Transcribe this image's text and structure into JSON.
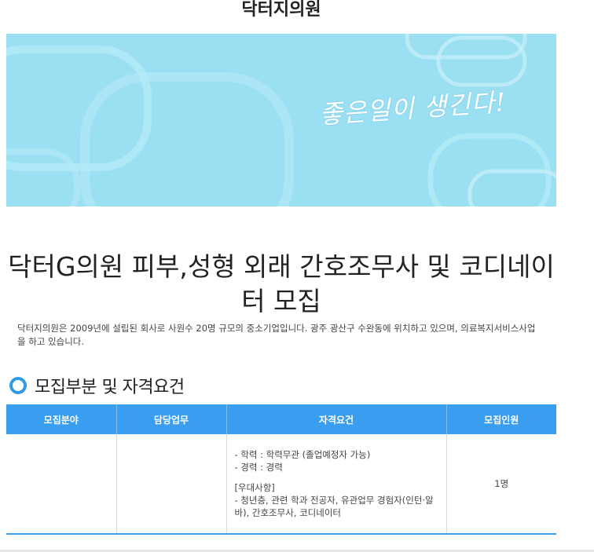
{
  "company": {
    "name": "닥터지의원"
  },
  "banner": {
    "slogan": "좋은일이 생긴다!"
  },
  "job": {
    "title": "닥터G의원 피부,성형 외래 간호조무사 및 코디네이터 모집",
    "intro": "닥터지의원은 2009년에 설립된 회사로 사원수 20명 규모의 중소기업입니다. 광주 광산구 수완동에 위치하고 있으며, 의료복지서비스사업을 하고 있습니다."
  },
  "section": {
    "title": "모집부분 및 자격요건"
  },
  "table": {
    "headers": [
      "모집분야",
      "담당업무",
      "자격요건",
      "모집인원"
    ],
    "row": {
      "field": "",
      "duty": "",
      "qualifications": {
        "lines": [
          "- 학력 : 학력무관 (졸업예정자 가능)",
          "- 경력 : 경력"
        ],
        "preferred_title": "[우대사항]",
        "preferred": "- 청년층, 관련 학과 전공자, 유관업무 경험자(인턴·알바), 간호조무사, 코디네이터"
      },
      "count": "1명"
    }
  },
  "colors": {
    "accent": "#3a9ef0",
    "banner": "#9bdff2"
  }
}
